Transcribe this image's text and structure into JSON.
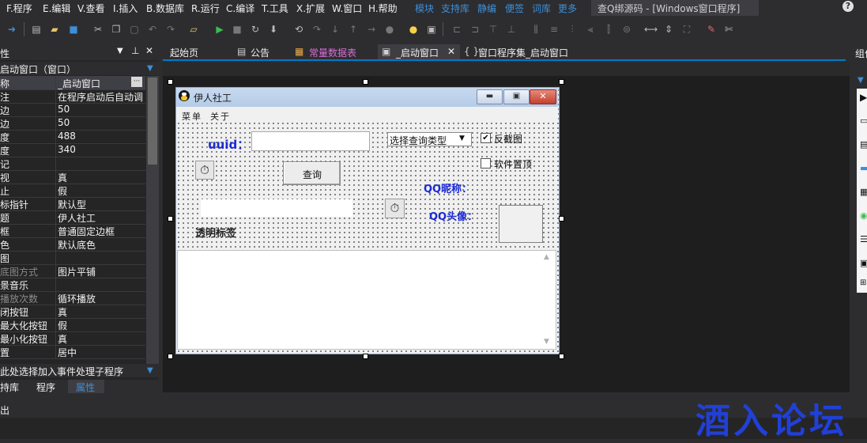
{
  "menubar": {
    "items": [
      "F.程序",
      "E.编辑",
      "V.查看",
      "I.插入",
      "B.数据库",
      "R.运行",
      "C.编译",
      "T.工具",
      "X.扩展",
      "W.窗口",
      "H.帮助"
    ],
    "links": [
      "模块",
      "支持库",
      "静编",
      "便签",
      "词库",
      "更多"
    ],
    "title": "查Q绑源码 - [Windows窗口程序]"
  },
  "left_panel": {
    "header": "性",
    "subheader": "启动窗口（窗口）",
    "properties": [
      {
        "k": "称",
        "v": "_启动窗口",
        "dim": false
      },
      {
        "k": "注",
        "v": "在程序启动后自动调",
        "dim": false
      },
      {
        "k": "边",
        "v": "50",
        "dim": false
      },
      {
        "k": "边",
        "v": "50",
        "dim": false
      },
      {
        "k": "度",
        "v": "488",
        "dim": false
      },
      {
        "k": "度",
        "v": "340",
        "dim": false
      },
      {
        "k": "记",
        "v": "",
        "dim": false
      },
      {
        "k": "视",
        "v": "真",
        "dim": false
      },
      {
        "k": "止",
        "v": "假",
        "dim": false
      },
      {
        "k": "标指针",
        "v": "默认型",
        "dim": false
      },
      {
        "k": "题",
        "v": "伊人社工",
        "dim": false
      },
      {
        "k": "框",
        "v": "普通固定边框",
        "dim": false
      },
      {
        "k": "色",
        "v": "默认底色",
        "dim": false
      },
      {
        "k": "图",
        "v": "",
        "dim": false
      },
      {
        "k": "底图方式",
        "v": "图片平铺",
        "dim": true
      },
      {
        "k": "景音乐",
        "v": "",
        "dim": false
      },
      {
        "k": "播放次数",
        "v": "循环播放",
        "dim": true
      },
      {
        "k": "闭按钮",
        "v": "真",
        "dim": false
      },
      {
        "k": "最大化按钮",
        "v": "假",
        "dim": false
      },
      {
        "k": "最小化按钮",
        "v": "真",
        "dim": false
      },
      {
        "k": "置",
        "v": "居中",
        "dim": false
      }
    ],
    "event_hint": "此处选择加入事件处理子程序",
    "tabs": [
      "持库",
      "程序",
      "属性"
    ]
  },
  "doc_tabs": {
    "start": "起始页",
    "notice": "公告",
    "constants": "常量数据表",
    "startup": "_启动窗口",
    "program_set": "窗口程序集_启动窗口"
  },
  "form": {
    "title": "伊人社工",
    "menu": [
      "菜单",
      "关于"
    ],
    "uuid_label": "uuid：",
    "uuid_value": "",
    "query_type": "选择查询类型",
    "reverse_check": "反截图",
    "topmost_check": "软件置顶",
    "query_button": "查询",
    "nickname_label": "QQ昵称：",
    "avatar_label": "QQ头像：",
    "transparent_label": "透明标签"
  },
  "right_panel": {
    "header": "组件"
  },
  "bottom": {
    "output": "出"
  },
  "watermark": "酒入论坛",
  "colors": {
    "accent": "#007acc",
    "link": "#3d8fd8",
    "form_label": "#1b2ad6"
  }
}
